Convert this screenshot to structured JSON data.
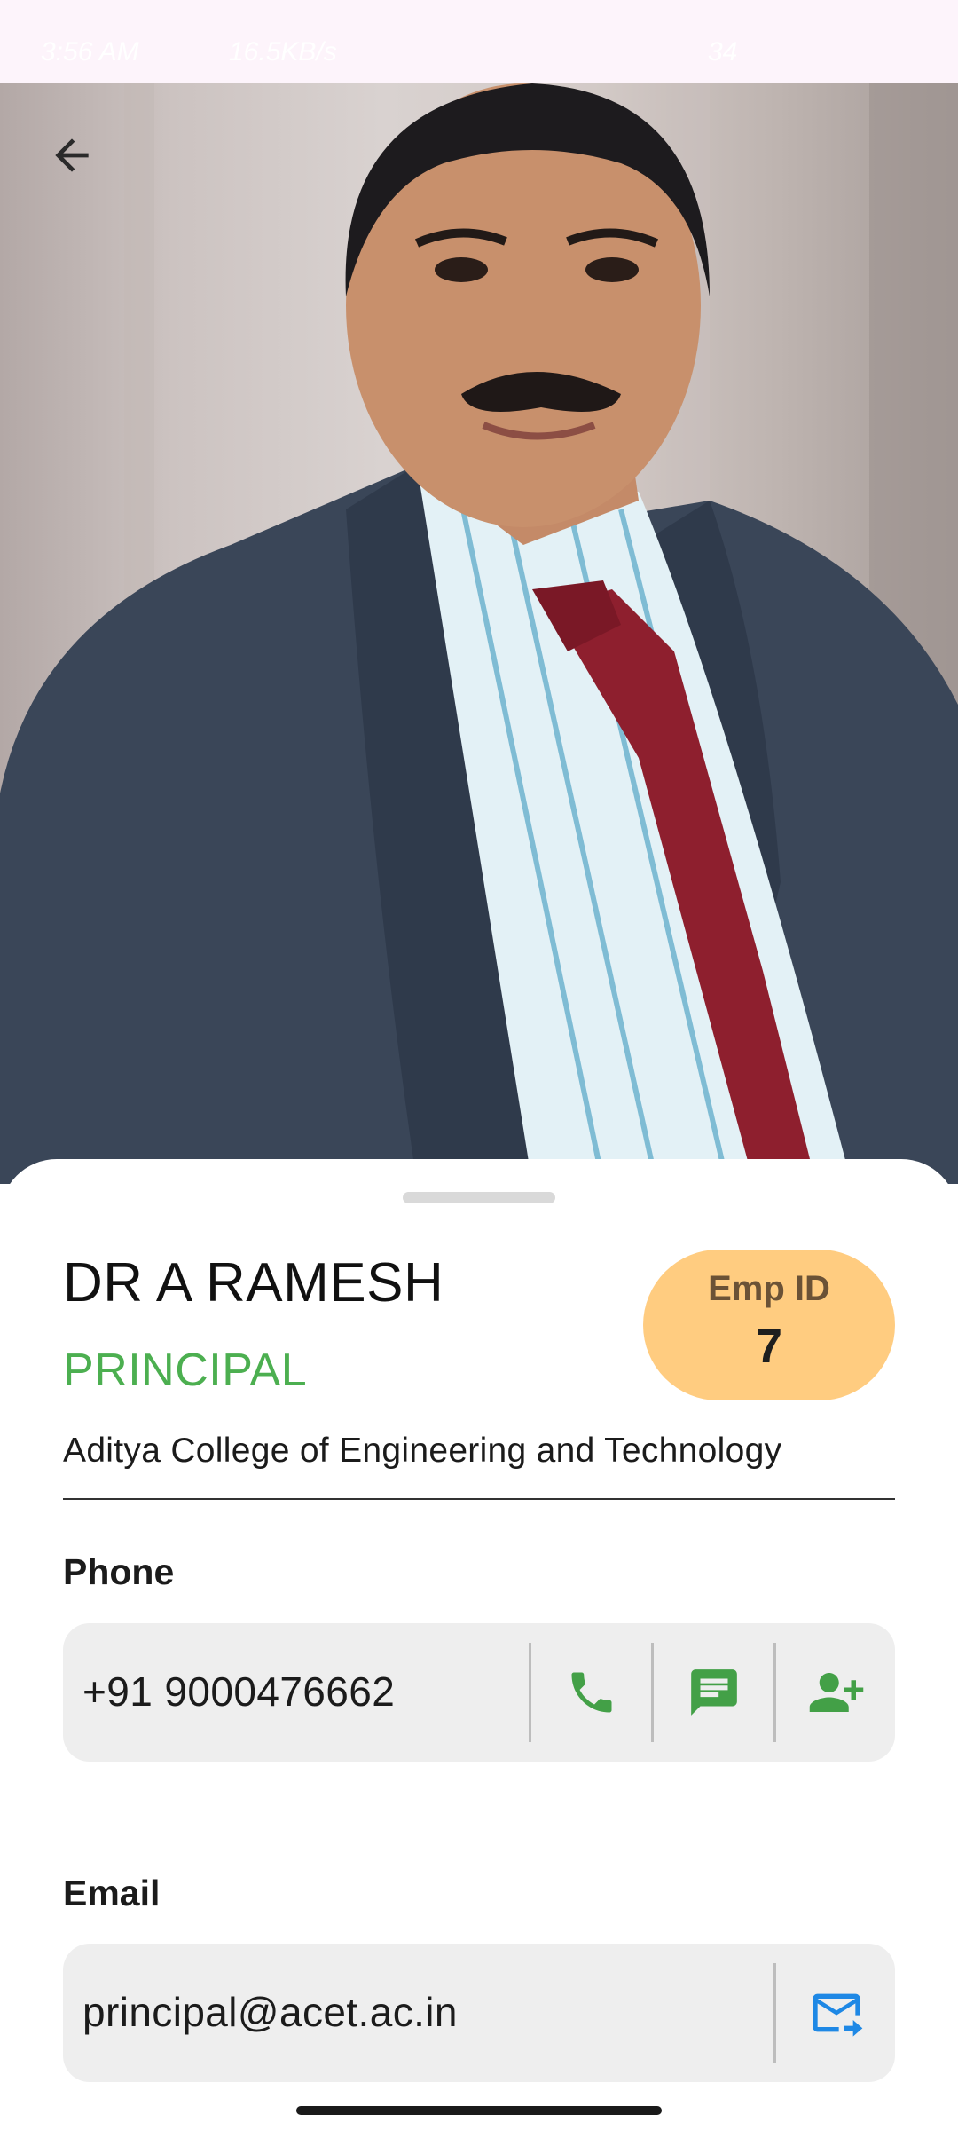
{
  "status_bar": {
    "time": "3:56 AM",
    "speed": "16.5KB/s",
    "battery": "34"
  },
  "profile": {
    "name": "DR A RAMESH",
    "designation": "PRINCIPAL",
    "emp_id_label": "Emp ID",
    "emp_id": "7",
    "college": "Aditya College of Engineering and Technology"
  },
  "phone": {
    "label": "Phone",
    "value": "+91 9000476662"
  },
  "email": {
    "label": "Email",
    "value": "principal@acet.ac.in"
  },
  "icons": {
    "back": "arrow-back-icon",
    "call": "phone-icon",
    "message": "message-icon",
    "add_contact": "add-contact-icon",
    "send_email": "forward-email-icon"
  },
  "colors": {
    "accent_green": "#4caf50",
    "badge_bg": "#ffcc80",
    "email_blue": "#1e88e5",
    "field_bg": "#eeeeee"
  }
}
